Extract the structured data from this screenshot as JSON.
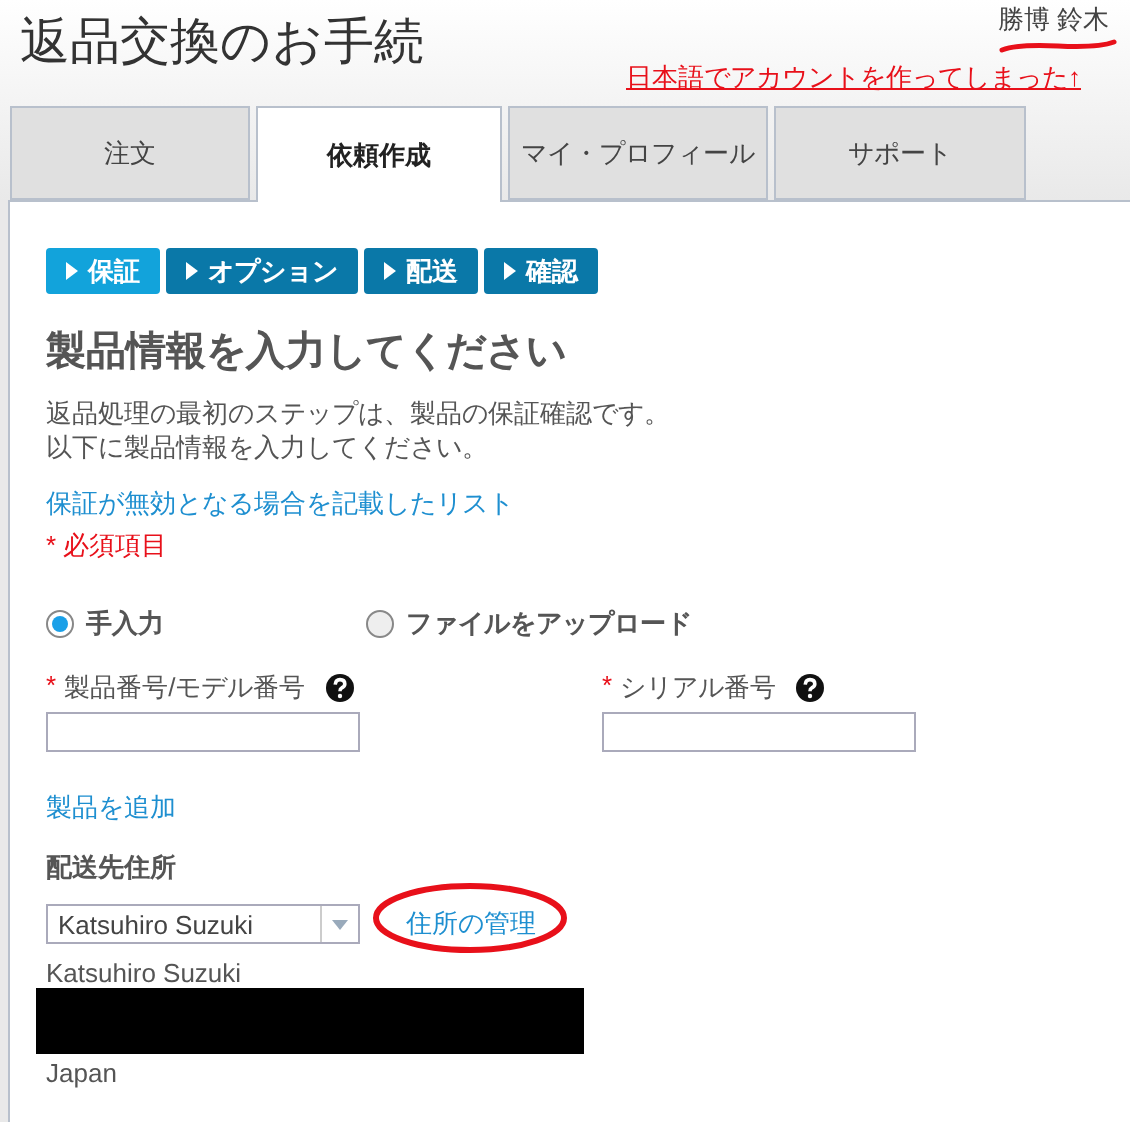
{
  "page": {
    "title": "返品交換のお手続",
    "user": {
      "name": "勝博 鈴木",
      "underlined": true
    },
    "annotation_link": "日本語でアカウントを作ってしまった↑"
  },
  "tabs": [
    {
      "label": "注文",
      "selected": false
    },
    {
      "label": "依頼作成",
      "selected": true
    },
    {
      "label": "マイ・プロフィール",
      "selected": false
    },
    {
      "label": "サポート",
      "selected": false
    }
  ],
  "steps": [
    {
      "label": "保証",
      "selected": true
    },
    {
      "label": "オプション",
      "selected": false
    },
    {
      "label": "配送",
      "selected": false
    },
    {
      "label": "確認",
      "selected": false
    }
  ],
  "form": {
    "heading": "製品情報を入力してください",
    "intro": [
      "返品処理の最初のステップは、製品の保証確認です。",
      "以下に製品情報を入力してください。"
    ],
    "warranty_link": "保証が無効となる場合を記載したリスト",
    "required_note": "* 必須項目",
    "entry_modes": [
      {
        "label": "手入力",
        "selected": true
      },
      {
        "label": "ファイルをアップロード",
        "selected": false
      }
    ],
    "fields": [
      {
        "required_mark": "*",
        "label": "製品番号/モデル番号"
      },
      {
        "required_mark": "*",
        "label": "シリアル番号"
      }
    ],
    "add_product_link": "製品を追加"
  },
  "shipping": {
    "label": "配送先住所",
    "selected_address": "Katsuhiro Suzuki",
    "manage_link": {
      "label": "住所の管理",
      "circled": true
    },
    "address_lines": [
      {
        "kind": "text",
        "text": "Katsuhiro Suzuki"
      },
      {
        "kind": "redacted"
      },
      {
        "kind": "text",
        "text": "Japan"
      }
    ]
  }
}
